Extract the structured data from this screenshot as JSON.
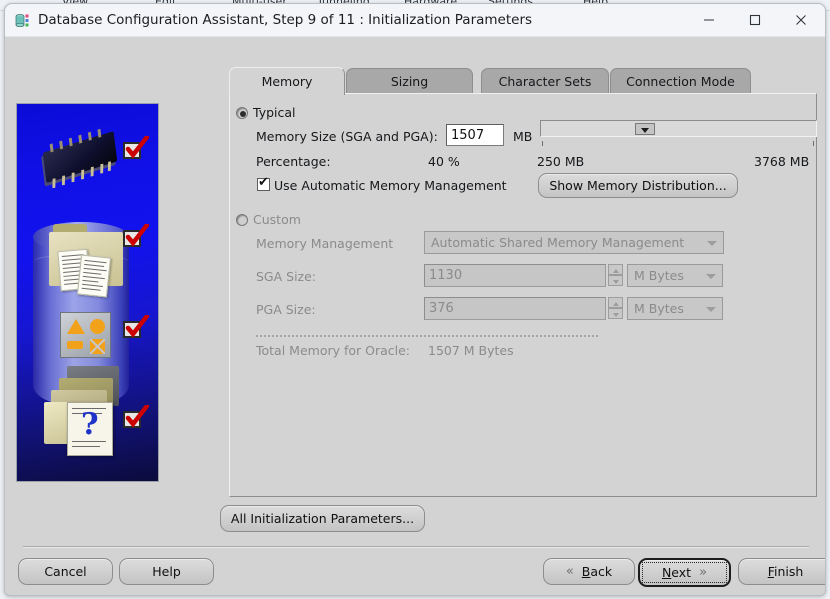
{
  "background_menubar": {
    "items": [
      "View",
      "Edit",
      "Multi-user",
      "Tunneling",
      "Hardware",
      "Settings",
      "Help"
    ]
  },
  "window": {
    "title": "Database Configuration Assistant, Step 9 of 11 : Initialization Parameters",
    "app_icon": "database-icon",
    "controls": {
      "minimize": "minimize-icon",
      "maximize": "maximize-icon",
      "close": "close-icon"
    }
  },
  "sidebar": {
    "alt": "oracle-database-configuration-illustration",
    "checkmarks": 4
  },
  "tabs": [
    {
      "label": "Memory",
      "selected": true
    },
    {
      "label": "Sizing",
      "selected": false
    },
    {
      "label": "Character Sets",
      "selected": false
    },
    {
      "label": "Connection Mode",
      "selected": false
    }
  ],
  "memory_tab": {
    "typical": {
      "label": "Typical",
      "selected": true,
      "memory_size_label": "Memory Size (SGA and PGA):",
      "memory_size_value": "1507",
      "memory_size_unit": "MB",
      "percentage_label": "Percentage:",
      "percentage_value": "40 %",
      "slider_min_label": "250 MB",
      "slider_max_label": "3768 MB",
      "slider_position_percent": 36,
      "auto_memory_label": "Use Automatic Memory Management",
      "auto_memory_checked": true,
      "show_distribution_button": "Show Memory Distribution..."
    },
    "custom": {
      "label": "Custom",
      "selected": false,
      "enabled": false,
      "memory_management_label": "Memory Management",
      "memory_management_value": "Automatic Shared Memory Management",
      "sga_label": "SGA Size:",
      "sga_value": "1130",
      "sga_unit": "M Bytes",
      "pga_label": "PGA Size:",
      "pga_value": "376",
      "pga_unit": "M Bytes",
      "total_label": "Total Memory for Oracle:",
      "total_value": "1507 M Bytes"
    }
  },
  "all_params_button": "All Initialization Parameters...",
  "footer": {
    "cancel": "Cancel",
    "help": "Help",
    "back": "Back",
    "next": "Next",
    "finish": "Finish",
    "next_focused": true
  },
  "colors": {
    "dialog_bg": "#d3d3d3",
    "titlebar_bg": "#f3f5f9",
    "tab_unselected": "#a8a8a8",
    "sidebar_blue": "#1212ef",
    "check_red": "#cc0000",
    "disabled_text": "#8b8b8b"
  }
}
